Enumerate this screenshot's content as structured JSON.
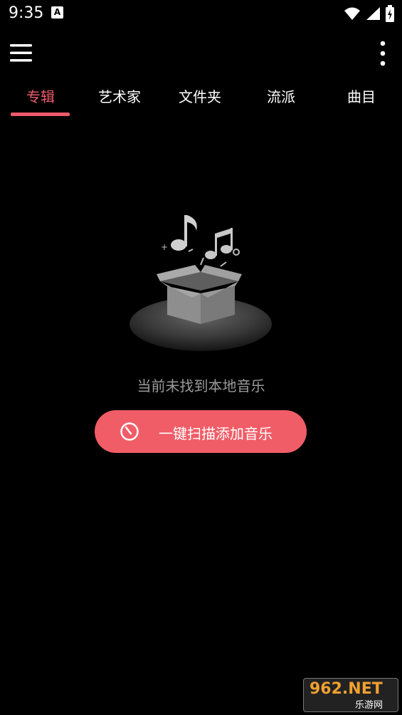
{
  "status_bar": {
    "time": "9:35",
    "notification_icon": "A"
  },
  "toolbar": {
    "menu_icon": "hamburger-menu-icon",
    "more_icon": "more-vertical-icon"
  },
  "tabs": [
    {
      "label": "专辑",
      "active": true
    },
    {
      "label": "艺术家",
      "active": false
    },
    {
      "label": "文件夹",
      "active": false
    },
    {
      "label": "流派",
      "active": false
    },
    {
      "label": "曲目",
      "active": false
    }
  ],
  "empty_state": {
    "message": "当前未找到本地音乐",
    "button_label": "一键扫描添加音乐"
  },
  "watermark": {
    "main": "962.NET",
    "sub": "乐游网"
  },
  "colors": {
    "accent": "#ef5a6a",
    "button": "#f05d67",
    "background": "#000000",
    "muted_text": "#9a9a9a"
  }
}
